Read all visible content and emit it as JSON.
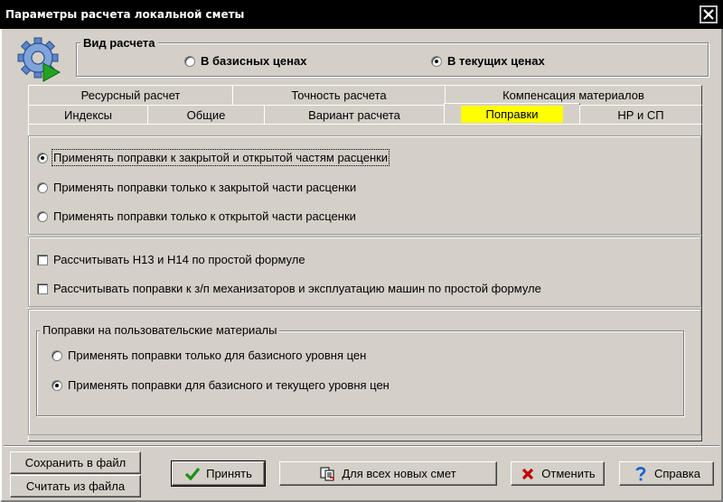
{
  "window": {
    "title": "Параметры расчета локальной сметы"
  },
  "calc_type": {
    "legend": "Вид расчета",
    "options": [
      {
        "label": "В базисных ценах",
        "selected": false
      },
      {
        "label": "В текущих ценах",
        "selected": true
      }
    ]
  },
  "tabs": {
    "row_back": [
      "Ресурсный расчет",
      "Точность расчета",
      "Компенсация материалов"
    ],
    "row_front": [
      "Индексы",
      "Общие",
      "Вариант расчета",
      "Поправки",
      "НР и СП"
    ],
    "active": "Поправки",
    "active_highlight_color": "#ffff00"
  },
  "popravki": {
    "apply_options": [
      {
        "label": "Применять поправки к закрытой и открытой частям расценки",
        "selected": true
      },
      {
        "label": "Применять поправки только к закрытой части расценки",
        "selected": false
      },
      {
        "label": "Применять поправки только к открытой части расценки",
        "selected": false
      }
    ],
    "checkboxes": [
      {
        "label": "Рассчитывать Н13 и Н14 по простой формуле",
        "checked": false
      },
      {
        "label": "Рассчитывать поправки к з/п механизаторов и эксплуатацию машин по простой формуле",
        "checked": false
      }
    ],
    "user_materials": {
      "legend": "Поправки на пользовательские материалы",
      "options": [
        {
          "label": "Применять поправки только для базисного уровня цен",
          "selected": false
        },
        {
          "label": "Применять поправки для базисного и текущего уровня цен",
          "selected": true
        }
      ]
    }
  },
  "buttons": {
    "save_to_file": "Сохранить в файл",
    "load_from_file": "Считать из файла",
    "accept": "Принять",
    "for_all_new": "Для всех новых смет",
    "cancel": "Отменить",
    "help": "Справка"
  },
  "icons": {
    "app": "gear-play-icon",
    "accept": "checkmark-icon",
    "for_all_new": "documents-icon",
    "cancel": "cross-icon",
    "help": "question-icon",
    "close": "close-icon"
  },
  "colors": {
    "accept_icon": "#1a8f1a",
    "cancel_icon": "#c00000",
    "help_icon": "#1060d0"
  }
}
